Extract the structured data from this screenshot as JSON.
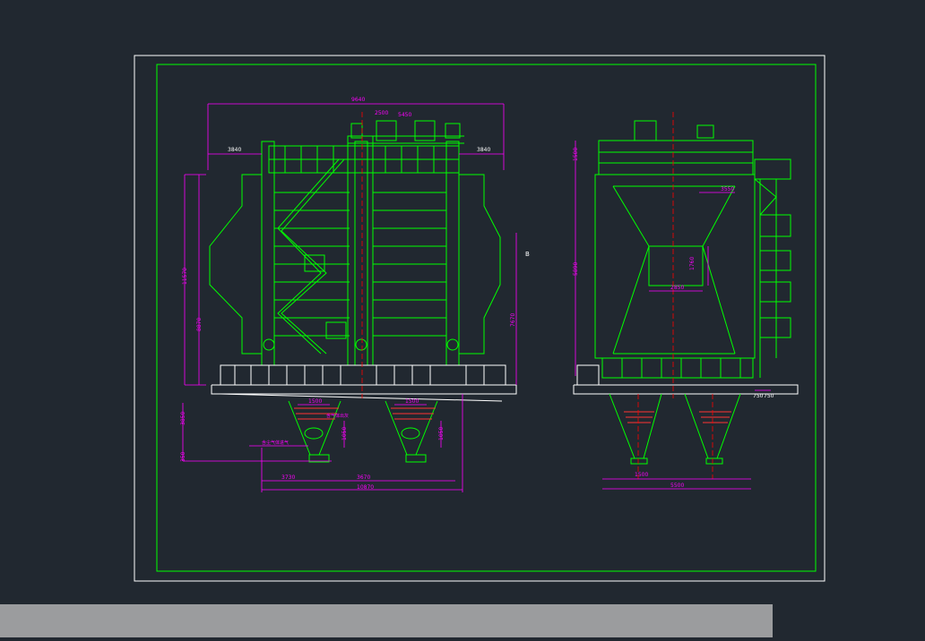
{
  "colors": {
    "background": "#212830",
    "sheet_border": "#ffffff",
    "frame": "#00ff00",
    "dimension": "#ff00ff",
    "annotation": "#ffffff",
    "section_mark": "#ff0000",
    "bottom_bar": "#9b9c9e"
  },
  "drawing": {
    "front_view": {
      "dim_top": "9640",
      "dim_platform_left": "3840",
      "dim_platform_right": "3840",
      "dim_left_total": "11570",
      "dim_left_middle": "8870",
      "dim_right_height": "7670",
      "dim_hopper_height": "3850",
      "dim_hopper_offset": "350",
      "dim_bottom_left": "3730",
      "dim_bottom_mid": "3670",
      "dim_bottom_total": "10870",
      "hopper_dim_a": "1500",
      "hopper_dim_b": "1500",
      "hopper_side_a": "1050",
      "hopper_side_b": "1050",
      "label_top_a": "2500",
      "label_top_b": "5450",
      "note_inlet": "含尘气体进气",
      "note_hopper": "含气体出灰",
      "section_marker": "B"
    },
    "side_view": {
      "dim_top_height": "1500",
      "dim_main_height": "5890",
      "dim_right_upper": "3550",
      "dim_window_h": "1760",
      "dim_window_w": "2850",
      "dim_hopper_width": "1500",
      "dim_bottom_total": "5500",
      "dim_leg_a": "750",
      "dim_leg_b": "750"
    }
  }
}
